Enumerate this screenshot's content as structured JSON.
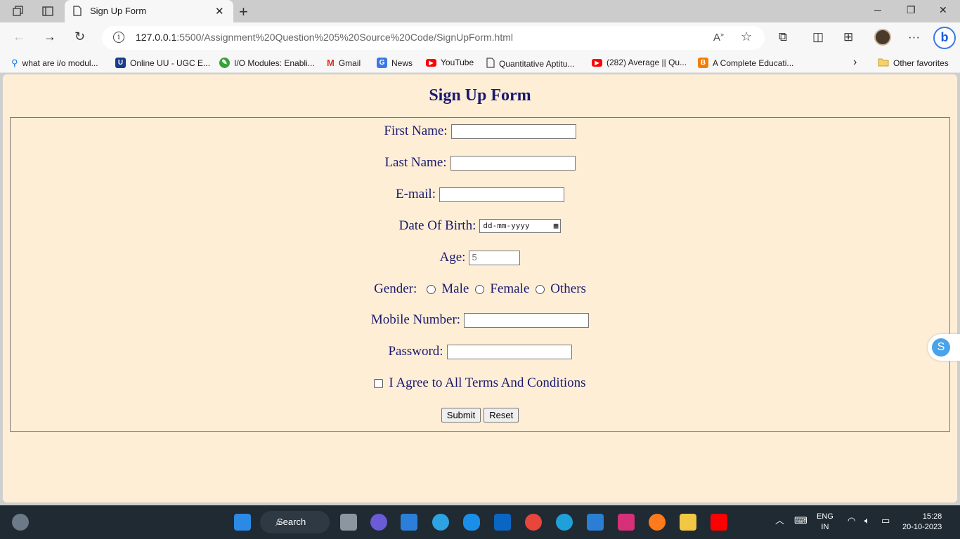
{
  "browser": {
    "tab_title": "Sign Up Form",
    "url_host": "127.0.0.1",
    "url_path": ":5500/Assignment%20Question%205%20Source%20Code/SignUpForm.html"
  },
  "favorites": [
    {
      "label": "what are i/o modul...",
      "icon": "search-icon",
      "color": "#1a73e8"
    },
    {
      "label": "Online UU - UGC E...",
      "icon": "uu-icon",
      "color": "#1a3c8c"
    },
    {
      "label": "I/O Modules: Enabli...",
      "icon": "leaf-icon",
      "color": "#3aa03a"
    },
    {
      "label": "Gmail",
      "icon": "gmail-icon",
      "color": "#d93025"
    },
    {
      "label": "News",
      "icon": "news-icon",
      "color": "#3b78e7"
    },
    {
      "label": "YouTube",
      "icon": "youtube-icon",
      "color": "#ff0000"
    },
    {
      "label": "Quantitative Aptitu...",
      "icon": "page-icon",
      "color": "#666666"
    },
    {
      "label": "(282) Average || Qu...",
      "icon": "youtube-icon",
      "color": "#ff0000"
    },
    {
      "label": "A Complete Educati...",
      "icon": "blogger-icon",
      "color": "#f57d00"
    }
  ],
  "other_favorites": "Other favorites",
  "form": {
    "heading": "Sign Up Form",
    "first_name_label": "First Name:",
    "last_name_label": "Last Name:",
    "email_label": "E-mail:",
    "dob_label": "Date Of Birth:",
    "dob_placeholder": "dd-mm-yyyy",
    "age_label": "Age:",
    "age_placeholder": "5",
    "gender_label": "Gender:",
    "gender_options": [
      "Male",
      "Female",
      "Others"
    ],
    "mobile_label": "Mobile Number:",
    "password_label": "Password:",
    "terms_label": "I Agree to All Terms And Conditions",
    "submit_label": "Submit",
    "reset_label": "Reset"
  },
  "taskbar": {
    "search_label": "Search",
    "lang": "ENG",
    "region": "IN",
    "time": "15:28",
    "date": "20-10-2023"
  },
  "colors": {
    "page_background": "#ffeed6",
    "form_text": "#191970"
  }
}
